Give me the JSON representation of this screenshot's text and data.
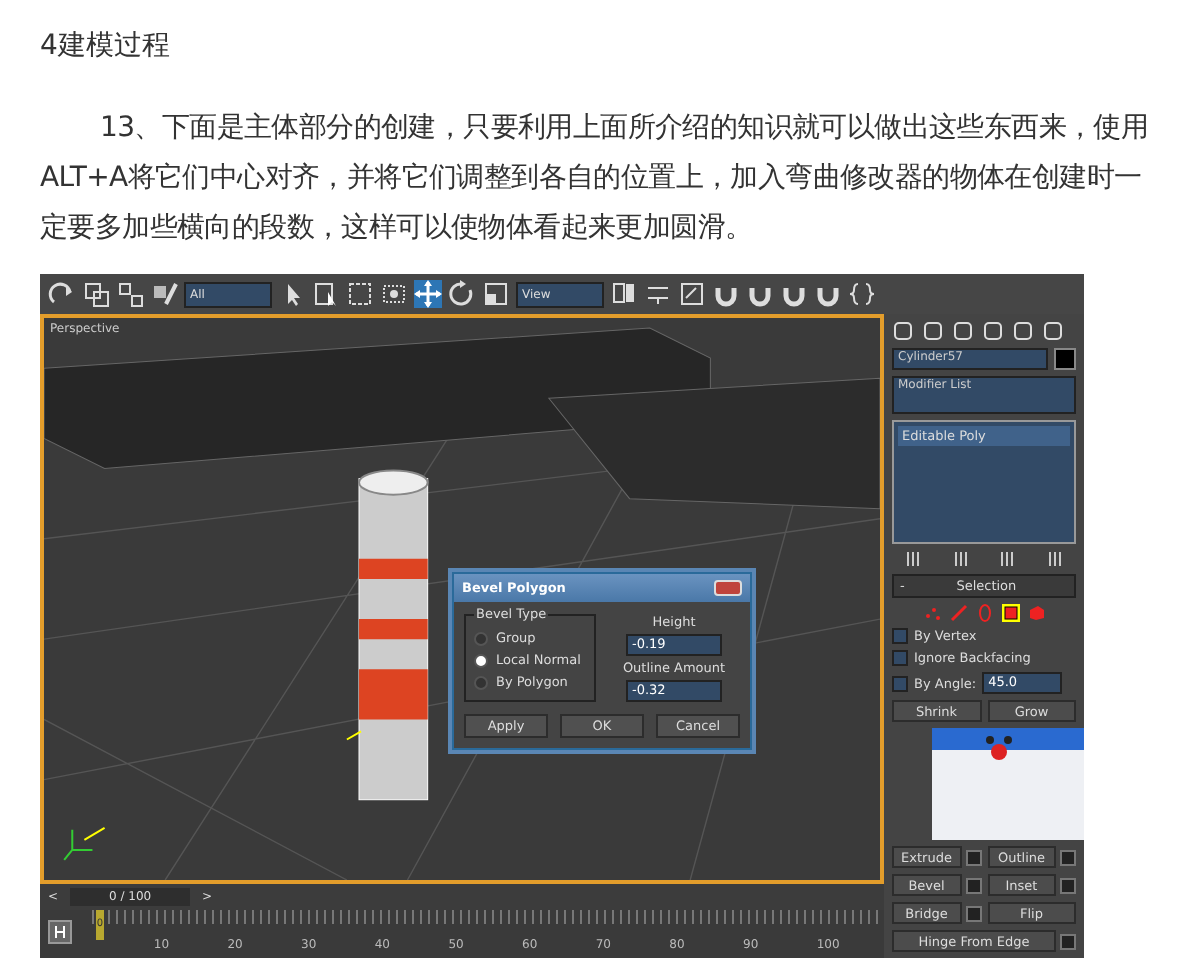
{
  "heading": "4建模过程",
  "paragraph": "13、下面是主体部分的创建，只要利用上面所介绍的知识就可以做出这些东西来，使用ALT+A将它们中心对齐，并将它们调整到各自的位置上，加入弯曲修改器的物体在创建时一定要多加些横向的段数，这样可以使物体看起来更加圆滑。",
  "app": {
    "toolbar": {
      "tools_left": [
        {
          "kind": "redo",
          "selected": false
        },
        {
          "kind": "link",
          "selected": false
        },
        {
          "kind": "unlink",
          "selected": false
        },
        {
          "kind": "bind",
          "selected": false
        }
      ],
      "selection_filter": "All",
      "tools_mid": [
        {
          "kind": "pointer",
          "selected": false
        },
        {
          "kind": "select-name",
          "selected": false
        },
        {
          "kind": "region",
          "selected": false
        },
        {
          "kind": "window",
          "selected": false
        },
        {
          "kind": "move",
          "selected": true
        },
        {
          "kind": "rotate",
          "selected": false
        },
        {
          "kind": "scale",
          "selected": false
        }
      ],
      "reference_coord": "View",
      "tools_right": [
        {
          "kind": "pivot",
          "selected": false
        },
        {
          "kind": "keyboard",
          "selected": false
        },
        {
          "kind": "snap",
          "selected": false
        },
        {
          "kind": "magnet",
          "selected": false
        },
        {
          "kind": "magnet",
          "selected": false
        },
        {
          "kind": "magnet",
          "selected": false
        },
        {
          "kind": "magnet",
          "selected": false
        },
        {
          "kind": "braces",
          "selected": false
        }
      ]
    },
    "viewport": {
      "label": "Perspective"
    },
    "dialog": {
      "title": "Bevel Polygon",
      "group_label": "Bevel Type",
      "options": [
        {
          "label": "Group",
          "selected": false
        },
        {
          "label": "Local Normal",
          "selected": true
        },
        {
          "label": "By Polygon",
          "selected": false
        }
      ],
      "height_label": "Height",
      "height_value": "-0.19",
      "outline_label": "Outline Amount",
      "outline_value": "-0.32",
      "buttons": [
        "Apply",
        "OK",
        "Cancel"
      ]
    },
    "panel": {
      "object_name": "Cylinder57",
      "modifier_list": "Modifier List",
      "stack": [
        {
          "label": "Editable Poly",
          "selected": true
        }
      ],
      "rollout_toggle": "-",
      "rollout_title": "Selection",
      "subobject_levels": [
        {
          "kind": "vertex",
          "selected": false
        },
        {
          "kind": "edge",
          "selected": false
        },
        {
          "kind": "border",
          "selected": false
        },
        {
          "kind": "polygon",
          "selected": true
        },
        {
          "kind": "element",
          "selected": false
        }
      ],
      "checkboxes": [
        {
          "label": "By Vertex",
          "checked": false
        },
        {
          "label": "Ignore Backfacing",
          "checked": false
        },
        {
          "label": "By Angle:",
          "checked": false
        }
      ],
      "angle_value": "45.0",
      "selection_buttons": [
        "Shrink",
        "Grow"
      ],
      "edit_buttons": [
        {
          "label": "Extrude",
          "settings": true
        },
        {
          "label": "Outline",
          "settings": true
        },
        {
          "label": "Bevel",
          "settings": true
        },
        {
          "label": "Inset",
          "settings": true
        },
        {
          "label": "Bridge",
          "settings": true
        },
        {
          "label": "Flip",
          "settings": false
        },
        {
          "label": "Hinge From Edge",
          "settings": true
        }
      ]
    },
    "timeline": {
      "prev": "<",
      "frame": "0 / 100",
      "level": 0,
      "next": ">",
      "marker": "0",
      "ticks": [
        "10",
        "20",
        "30",
        "40",
        "50",
        "60",
        "70",
        "80",
        "90",
        "100"
      ]
    }
  }
}
